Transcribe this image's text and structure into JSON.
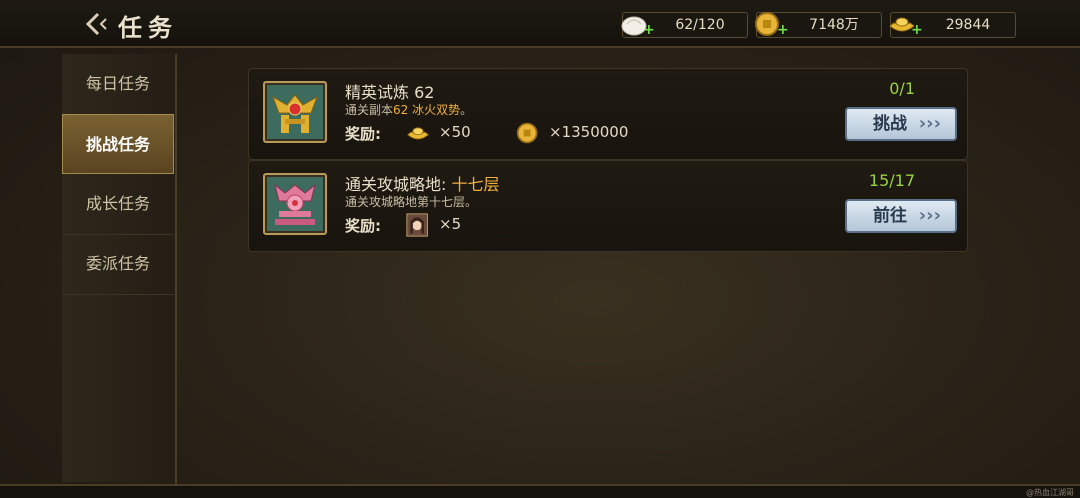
{
  "header": {
    "title": "任务",
    "resources": [
      {
        "name": "bun-icon",
        "value": "62/120"
      },
      {
        "name": "copper-coin-icon",
        "value": "7148万"
      },
      {
        "name": "gold-ingot-icon",
        "value": "29844"
      }
    ]
  },
  "sidebar": {
    "tabs": [
      {
        "label": "每日任务",
        "active": false
      },
      {
        "label": "挑战任务",
        "active": true
      },
      {
        "label": "成长任务",
        "active": false
      },
      {
        "label": "委派任务",
        "active": false
      }
    ]
  },
  "tasks": [
    {
      "name": "精英试炼 62",
      "desc_prefix": "通关副本",
      "desc_highlight": "62 冰火双势",
      "desc_suffix": "。",
      "reward_label": "奖励:",
      "rewards": [
        {
          "icon": "gold-ingot-icon",
          "text": "×50"
        },
        {
          "icon": "copper-coin-icon",
          "text": "×1350000"
        }
      ],
      "progress": "0/1",
      "button": "挑战"
    },
    {
      "name_prefix": "通关攻城略地: ",
      "name_highlight": "十七层",
      "desc": "通关攻城略地第十七层。",
      "reward_label": "奖励:",
      "rewards": [
        {
          "icon": "hero-portrait-icon",
          "text": "×5"
        }
      ],
      "progress": "15/17",
      "button": "前往"
    }
  ],
  "watermark": "@热血江湖哥",
  "colors": {
    "accent_gold": "#f0b040",
    "progress_green": "#9ad43c",
    "button_blue": "#b4c6d8"
  }
}
